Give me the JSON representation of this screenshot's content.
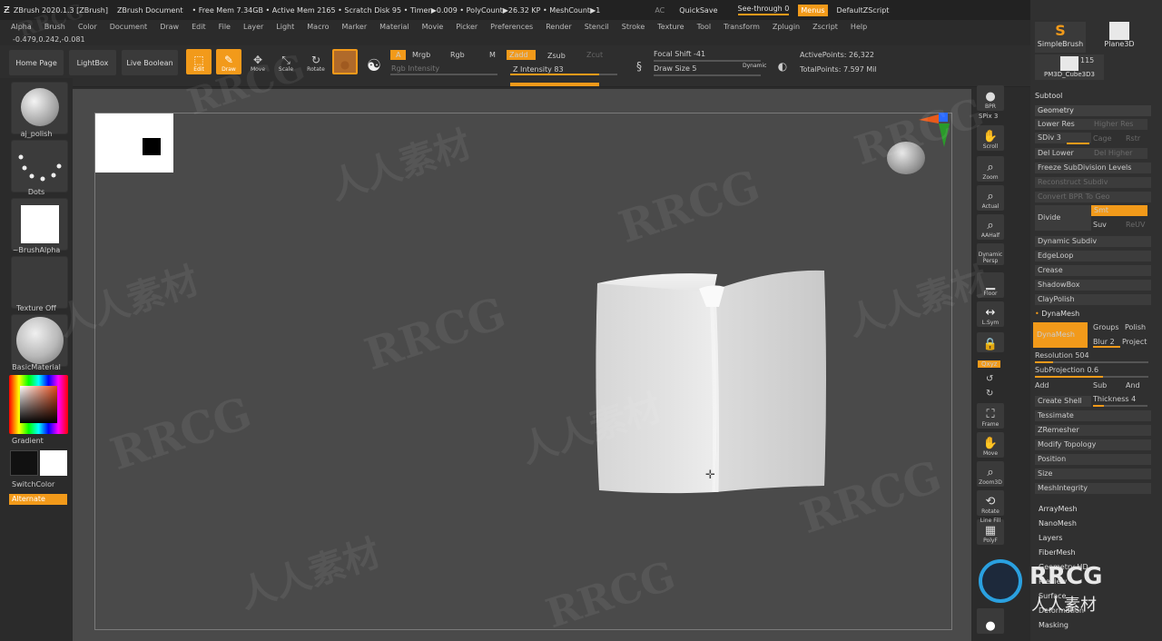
{
  "titlebar": {
    "app_title": "ZBrush 2020.1.3 [ZBrush]",
    "document": "ZBrush Document",
    "free_mem": "• Free Mem 7.34GB • Active Mem 2165 • Scratch Disk 95 • Timer▶0.009 • PolyCount▶26.32 KP • MeshCount▶1",
    "ac": "AC",
    "quicksave": "QuickSave",
    "seethrough": "See-through  0",
    "menus": "Menus",
    "default_zscript": "DefaultZScript"
  },
  "menu": {
    "items": [
      "Alpha",
      "Brush",
      "Color",
      "Document",
      "Draw",
      "Edit",
      "File",
      "Layer",
      "Light",
      "Macro",
      "Marker",
      "Material",
      "Movie",
      "Picker",
      "Preferences",
      "Render",
      "Stencil",
      "Stroke",
      "Texture",
      "Tool",
      "Transform",
      "Zplugin",
      "Zscript",
      "Help"
    ]
  },
  "coords": "-0.479,0.242,-0.081",
  "shelf": {
    "home_page": "Home Page",
    "lightbox": "LightBox",
    "live_boolean": "Live Boolean",
    "edit": "Edit",
    "draw": "Draw",
    "move": "Move",
    "scale": "Scale",
    "rotate": "Rotate",
    "a": "A",
    "mrgb": "Mrgb",
    "rgb": "Rgb",
    "m": "M",
    "zadd": "Zadd",
    "zsub": "Zsub",
    "zcut": "Zcut",
    "rgb_intensity": "Rgb Intensity",
    "z_intensity": "Z Intensity 83",
    "z_intensity_value": 83,
    "focal_shift": "Focal Shift -41",
    "draw_size": "Draw Size 5",
    "dynamic": "Dynamic",
    "active_points": "ActivePoints: 26,322",
    "total_points": "TotalPoints: 7.597 Mil"
  },
  "left": {
    "brush": "aj_polish",
    "stroke": "Dots",
    "alpha": "~BrushAlpha",
    "texture": "Texture Off",
    "material": "BasicMaterial",
    "gradient": "Gradient",
    "switchcolor": "SwitchColor",
    "alternate": "Alternate"
  },
  "rightbar": {
    "bpr": "BPR",
    "spix": "SPix 3",
    "scroll": "Scroll",
    "zoom": "Zoom",
    "actual": "Actual",
    "aahalf": "AAHalf",
    "dynamic": "Dynamic",
    "persp": "Persp",
    "floor": "Floor",
    "lsym": "L.Sym",
    "xyz": "Qxyz",
    "frame": "Frame",
    "move": "Move",
    "zoom3d": "Zoom3D",
    "rotate": "Rotate",
    "linefill": "Line Fill",
    "polyf": "PolyF"
  },
  "tray": {
    "simple_brush": "SimpleBrush",
    "plane3d": "Plane3D",
    "pm3d": "PM3D_Cube3D3",
    "count": "115",
    "subtool": "Subtool",
    "geometry": "Geometry",
    "lower_res": "Lower Res",
    "higher_res": "Higher Res",
    "sdiv": "SDiv 3",
    "cage": "Cage",
    "rstr": "Rstr",
    "del_lower": "Del Lower",
    "del_higher": "Del Higher",
    "freeze": "Freeze SubDivision Levels",
    "reconstruct": "Reconstruct Subdiv",
    "convert_bpr": "Convert BPR To Geo",
    "divide": "Divide",
    "smt": "Smt",
    "suv": "Suv",
    "reuv": "ReUV",
    "dynamic_subdiv": "Dynamic Subdiv",
    "edgeloop": "EdgeLoop",
    "crease": "Crease",
    "shadowbox": "ShadowBox",
    "claypolish": "ClayPolish",
    "dynamesh_hdr": "DynaMesh",
    "dynamesh_btn": "DynaMesh",
    "groups": "Groups",
    "polish": "Polish",
    "blur": "Blur 2",
    "project": "Project",
    "resolution": "Resolution 504",
    "subprojection": "SubProjection 0.6",
    "add": "Add",
    "sub": "Sub",
    "and": "And",
    "create_shell": "Create Shell",
    "thickness": "Thickness 4",
    "tessimate": "Tessimate",
    "zremesher": "ZRemesher",
    "modify_topology": "Modify Topology",
    "position": "Position",
    "size": "Size",
    "meshintegrity": "MeshIntegrity",
    "arraymesh": "ArrayMesh",
    "nanomesh": "NanoMesh",
    "layers": "Layers",
    "fibermesh": "FiberMesh",
    "geometry_hd": "Geometry HD",
    "preview": "Preview",
    "surface": "Surface",
    "deformation": "Deformation",
    "masking": "Masking"
  },
  "watermark": {
    "latin": "RRCG",
    "cjk": "人人素材"
  },
  "colors": {
    "accent": "#f29a1a",
    "viewport": "#4a4a4a",
    "panel": "#2b2b2b"
  }
}
